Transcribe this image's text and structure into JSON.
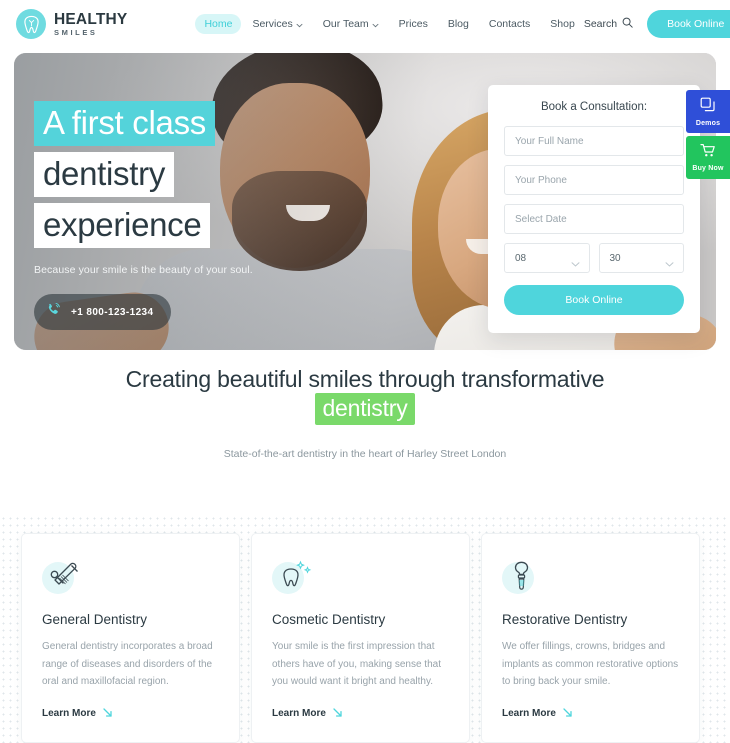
{
  "header": {
    "brand": {
      "title": "HEALTHY",
      "subtitle": "SMILES",
      "logo_icon": "tooth-icon"
    },
    "nav": [
      {
        "label": "Home",
        "active": true,
        "has_caret": false
      },
      {
        "label": "Services",
        "active": false,
        "has_caret": true
      },
      {
        "label": "Our Team",
        "active": false,
        "has_caret": true
      },
      {
        "label": "Prices",
        "active": false,
        "has_caret": false
      },
      {
        "label": "Blog",
        "active": false,
        "has_caret": false
      },
      {
        "label": "Contacts",
        "active": false,
        "has_caret": false
      },
      {
        "label": "Shop",
        "active": false,
        "has_caret": false
      }
    ],
    "search_label": "Search",
    "search_icon": "magnifier-icon",
    "book_button": "Book Online"
  },
  "hero": {
    "headline_line1": "A first class",
    "headline_line2": "dentistry",
    "headline_line3": "experience",
    "subtitle": "Because your smile is the beauty of your soul.",
    "phone_number": "+1 800-123-1234",
    "phone_icon": "phone-ring-icon"
  },
  "booking": {
    "title": "Book a Consultation:",
    "name_placeholder": "Your Full Name",
    "name_value": "",
    "phone_placeholder": "Your Phone",
    "phone_value": "",
    "date_placeholder": "Select Date",
    "date_value": "",
    "hour_value": "08",
    "minute_value": "30",
    "submit_label": "Book Online"
  },
  "side_tabs": [
    {
      "label": "Demos",
      "icon": "layers-icon",
      "color": "#2f4fd8"
    },
    {
      "label": "Buy Now",
      "icon": "cart-icon",
      "color": "#22c55e"
    }
  ],
  "section": {
    "heading_part1": "Creating beautiful smiles through",
    "heading_part2": "transformative",
    "heading_highlight": "dentistry",
    "subtitle": "State-of-the-art dentistry in the heart of Harley Street London",
    "highlight_color": "#7ad96a"
  },
  "cards": [
    {
      "icon": "dental-tools-icon",
      "title": "General Dentistry",
      "description": "General dentistry incorporates a broad range of diseases and disorders of the oral and maxillofacial region.",
      "link_label": "Learn More",
      "link_icon": "arrow-down-right-icon"
    },
    {
      "icon": "sparkling-tooth-icon",
      "title": "Cosmetic Dentistry",
      "description": "Your smile is the first impression that others have of you, making sense that you would want it bright and healthy.",
      "link_label": "Learn More",
      "link_icon": "arrow-down-right-icon"
    },
    {
      "icon": "dental-implant-icon",
      "title": "Restorative Dentistry",
      "description": "We offer fillings, crowns, bridges and implants as common restorative options to bring back your smile.",
      "link_label": "Learn More",
      "link_icon": "arrow-down-right-icon"
    }
  ],
  "theme": {
    "accent_teal": "#4fd5dc",
    "accent_teal_light": "#d7f6f7",
    "text_dark": "#2b3a42",
    "text_muted": "#98a3aa",
    "green": "#7ad96a"
  }
}
